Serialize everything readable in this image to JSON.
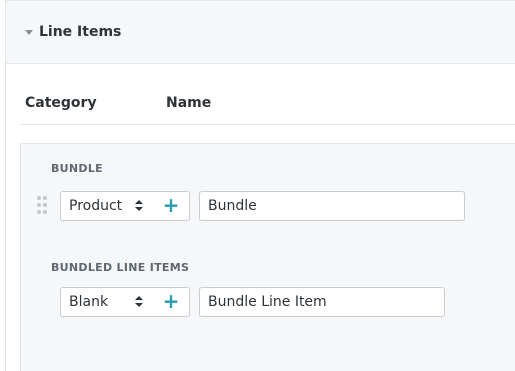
{
  "panel": {
    "title": "Line Items"
  },
  "columns": {
    "category": "Category",
    "name": "Name"
  },
  "groups": [
    {
      "label": "BUNDLE",
      "category_value": "Product",
      "name_value": "Bundle",
      "add_symbol": "+"
    },
    {
      "label": "BUNDLED LINE ITEMS",
      "category_value": "Blank",
      "name_value": "Bundle Line Item",
      "add_symbol": "+"
    }
  ],
  "colors": {
    "accent": "#2a9bb0",
    "panel_bg": "#f6f7f8",
    "border": "#e3e5e7"
  }
}
